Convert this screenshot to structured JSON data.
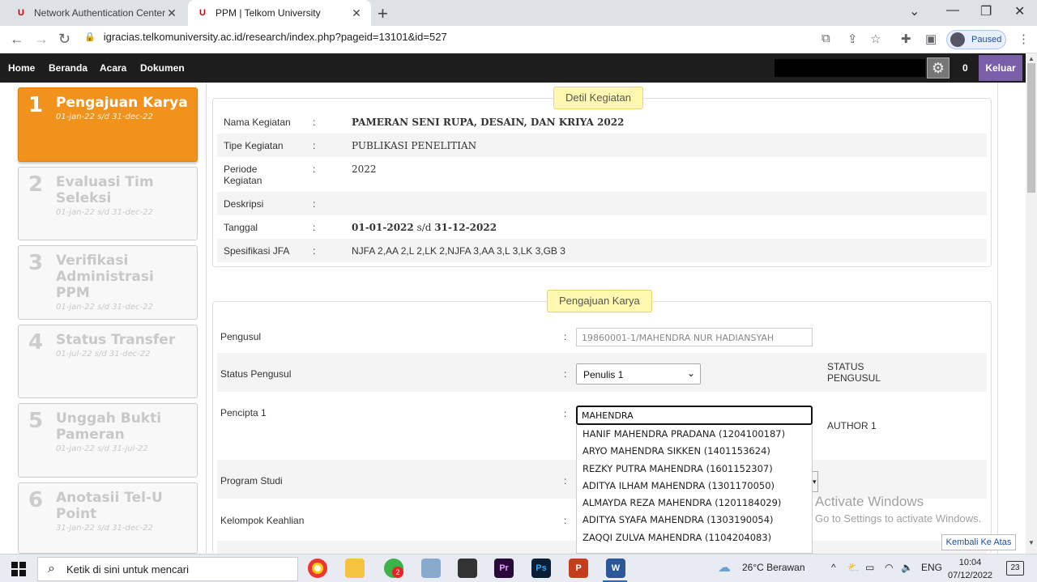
{
  "browser": {
    "tabs": [
      {
        "title": "Network Authentication Center |"
      },
      {
        "title": "PPM | Telkom University"
      }
    ],
    "url": "igracias.telkomuniversity.ac.id/research/index.php?pageid=13101&id=527",
    "profile_label": "Paused"
  },
  "site": {
    "menu": [
      "Home",
      "Beranda",
      "Acara",
      "Dokumen"
    ],
    "notif_count": "0",
    "logout_label": "Keluar"
  },
  "steps": [
    {
      "num": "1",
      "name": "Pengajuan Karya",
      "date": "01-jan-22 s/d 31-dec-22",
      "active": true
    },
    {
      "num": "2",
      "name": "Evaluasi Tim Seleksi",
      "date": "01-jan-22 s/d 31-dec-22",
      "active": false
    },
    {
      "num": "3",
      "name": "Verifikasi Administrasi PPM",
      "date": "01-jan-22 s/d 31-dec-22",
      "active": false
    },
    {
      "num": "4",
      "name": "Status Transfer",
      "date": "01-jul-22 s/d 31-dec-22",
      "active": false
    },
    {
      "num": "5",
      "name": "Unggah Bukti Pameran",
      "date": "01-jan-22 s/d 31-jul-22",
      "active": false
    },
    {
      "num": "6",
      "name": "Anotasii Tel-U Point",
      "date": "31-jan-22 s/d 31-dec-22",
      "active": false
    }
  ],
  "detail": {
    "legend": "Detil Kegiatan",
    "rows": [
      {
        "label": "Nama Kegiatan",
        "value": "PAMERAN SENI RUPA, DESAIN, DAN KRIYA 2022"
      },
      {
        "label": "Tipe Kegiatan",
        "value": "PUBLIKASI PENELITIAN"
      },
      {
        "label": "Periode Kegiatan",
        "value": "2022"
      },
      {
        "label": "Deskripsi",
        "value": ""
      },
      {
        "label": "Tanggal",
        "value_start": "01-01-2022",
        "value_sep": " s/d ",
        "value_end": "31-12-2022"
      },
      {
        "label": "Spesifikasi JFA",
        "value": "NJFA 2,AA 2,L 2,LK 2,NJFA 3,AA 3,L 3,LK 3,GB 3"
      }
    ]
  },
  "form": {
    "legend": "Pengajuan Karya",
    "pengusul_label": "Pengusul",
    "pengusul_value": "19860001-1/MAHENDRA NUR HADIANSYAH",
    "status_label": "Status Pengusul",
    "status_value": "Penulis 1",
    "status_right": "STATUS PENGUSUL",
    "pencipta_label": "Pencipta 1",
    "pencipta_value": "MAHENDRA",
    "pencipta_right": "AUTHOR 1",
    "prodi_label": "Program Studi",
    "kk_label": "Kelompok Keahlian",
    "suggestions": [
      "HANIF MAHENDRA PRADANA (1204100187)",
      "ARYO MAHENDRA SIKKEN (1401153624)",
      "REZKY PUTRA MAHENDRA (1601152307)",
      "ADITYA ILHAM MAHENDRA (1301170050)",
      "ALMAYDA REZA MAHENDRA (1201184029)",
      "ADITYA SYAFA MAHENDRA (1303190054)",
      "ZAQQI ZULVA MAHENDRA (1104204083)"
    ]
  },
  "watermark": {
    "line1": "Activate Windows",
    "line2": "Go to Settings to activate Windows."
  },
  "back_to_top": "Kembali Ke Atas",
  "taskbar": {
    "search_placeholder": "Ketik di sini untuk mencari",
    "weather": "26°C  Berawan",
    "lang": "ENG",
    "time": "10:04",
    "date": "07/12/2022",
    "whatsapp_badge": "2",
    "notif_badge": "23"
  }
}
